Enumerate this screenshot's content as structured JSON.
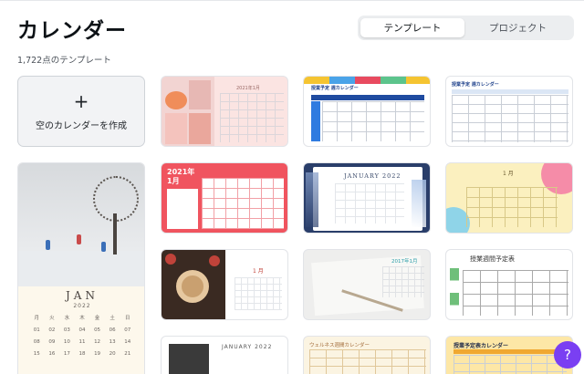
{
  "header": {
    "title": "カレンダー",
    "count": "1,722点のテンプレート"
  },
  "tabs": [
    {
      "label": "テンプレート",
      "active": true
    },
    {
      "label": "プロジェクト",
      "active": false
    }
  ],
  "create_card": {
    "plus": "+",
    "label": "空のカレンダーを作成"
  },
  "templates": {
    "winter": {
      "month": "JAN",
      "year": "2022",
      "weekdays": [
        "月",
        "火",
        "水",
        "木",
        "金",
        "土",
        "日"
      ],
      "days": [
        "01",
        "02",
        "03",
        "04",
        "05",
        "06",
        "07",
        "08",
        "09",
        "10",
        "11",
        "12",
        "13",
        "14",
        "15",
        "16",
        "17",
        "18",
        "19",
        "20",
        "21"
      ]
    },
    "pink_photo": {
      "heading": "2021年1月"
    },
    "schedule_blue": {
      "heading": "授業予定 週カレンダー"
    },
    "schedule_plain": {
      "heading": "授業予定 週カレンダー"
    },
    "red": {
      "year_month": "2021年",
      "month": "1月"
    },
    "navy": {
      "heading": "JANUARY 2022",
      "weekdays": [
        "S",
        "M",
        "T",
        "W",
        "T",
        "F",
        "S"
      ]
    },
    "yellow": {
      "heading": "1 月"
    },
    "donut": {
      "heading": "1 月"
    },
    "pencil": {
      "heading": "2017年1月"
    },
    "handwritten": {
      "heading": "授業週間予定表"
    },
    "jan2022": {
      "heading": "JANUARY 2022"
    },
    "wellness": {
      "heading": "ウェルネス週間カレンダー"
    },
    "lesson_yellow": {
      "heading": "授業予定表カレンダー"
    }
  },
  "help": {
    "label": "?"
  },
  "colors": {
    "accent": "#7a3ff2",
    "help_button": "#7a3ff2"
  }
}
